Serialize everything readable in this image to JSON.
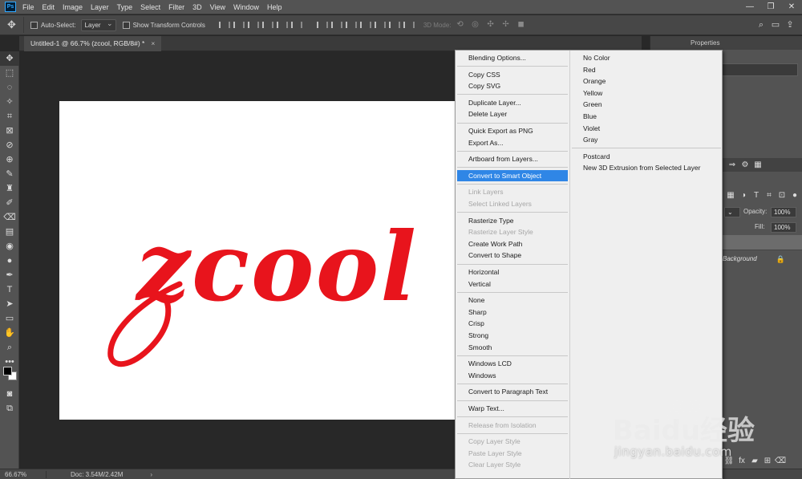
{
  "app": {
    "logo": "Ps"
  },
  "menubar": {
    "items": [
      "File",
      "Edit",
      "Image",
      "Layer",
      "Type",
      "Select",
      "Filter",
      "3D",
      "View",
      "Window",
      "Help"
    ]
  },
  "window_controls": {
    "minimize": "—",
    "restore": "❐",
    "close": "✕"
  },
  "options": {
    "auto_select_label": "Auto-Select:",
    "layer_select": "Layer",
    "show_transform_label": "Show Transform Controls",
    "mode_3d_label": "3D Mode:"
  },
  "document": {
    "tab_title": "Untitled-1 @ 66.7% (zcool, RGB/8#) *",
    "tab_close": "×",
    "canvas_text": "zcool",
    "text_color": "#e8141c"
  },
  "statusbar": {
    "zoom": "66.67%",
    "doc_size": "Doc: 3.54M/2.42M",
    "arrow": "›"
  },
  "panels": {
    "tab_label": "Properties",
    "opacity_label": "Opacity:",
    "opacity_value": "100%",
    "fill_label": "Fill:",
    "fill_value": "100%",
    "background_layer_name": "Background"
  },
  "context_menu": {
    "left": [
      {
        "label": "Blending Options...",
        "state": "normal"
      },
      {
        "sep": true
      },
      {
        "label": "Copy CSS",
        "state": "normal"
      },
      {
        "label": "Copy SVG",
        "state": "normal"
      },
      {
        "sep": true
      },
      {
        "label": "Duplicate Layer...",
        "state": "normal"
      },
      {
        "label": "Delete Layer",
        "state": "normal"
      },
      {
        "sep": true
      },
      {
        "label": "Quick Export as PNG",
        "state": "normal"
      },
      {
        "label": "Export As...",
        "state": "normal"
      },
      {
        "sep": true
      },
      {
        "label": "Artboard from Layers...",
        "state": "normal"
      },
      {
        "sep": true
      },
      {
        "label": "Convert to Smart Object",
        "state": "selected"
      },
      {
        "sep": true
      },
      {
        "label": "Link Layers",
        "state": "disabled"
      },
      {
        "label": "Select Linked Layers",
        "state": "disabled"
      },
      {
        "sep": true
      },
      {
        "label": "Rasterize Type",
        "state": "normal"
      },
      {
        "label": "Rasterize Layer Style",
        "state": "disabled"
      },
      {
        "label": "Create Work Path",
        "state": "normal"
      },
      {
        "label": "Convert to Shape",
        "state": "normal"
      },
      {
        "sep": true
      },
      {
        "label": "Horizontal",
        "state": "normal"
      },
      {
        "label": "Vertical",
        "state": "normal"
      },
      {
        "sep": true
      },
      {
        "label": "None",
        "state": "normal"
      },
      {
        "label": "Sharp",
        "state": "normal"
      },
      {
        "label": "Crisp",
        "state": "normal"
      },
      {
        "label": "Strong",
        "state": "normal"
      },
      {
        "label": "Smooth",
        "state": "normal"
      },
      {
        "sep": true
      },
      {
        "label": "Windows LCD",
        "state": "normal"
      },
      {
        "label": "Windows",
        "state": "normal"
      },
      {
        "sep": true
      },
      {
        "label": "Convert to Paragraph Text",
        "state": "normal"
      },
      {
        "sep": true
      },
      {
        "label": "Warp Text...",
        "state": "normal"
      },
      {
        "sep": true
      },
      {
        "label": "Release from Isolation",
        "state": "disabled"
      },
      {
        "sep": true
      },
      {
        "label": "Copy Layer Style",
        "state": "disabled"
      },
      {
        "label": "Paste Layer Style",
        "state": "disabled"
      },
      {
        "label": "Clear Layer Style",
        "state": "disabled"
      }
    ],
    "right": [
      {
        "label": "No Color",
        "state": "normal"
      },
      {
        "label": "Red",
        "state": "normal"
      },
      {
        "label": "Orange",
        "state": "normal"
      },
      {
        "label": "Yellow",
        "state": "normal"
      },
      {
        "label": "Green",
        "state": "normal"
      },
      {
        "label": "Blue",
        "state": "normal"
      },
      {
        "label": "Violet",
        "state": "normal"
      },
      {
        "label": "Gray",
        "state": "normal"
      },
      {
        "sep": true
      },
      {
        "label": "Postcard",
        "state": "normal"
      },
      {
        "label": "New 3D Extrusion from Selected Layer",
        "state": "normal"
      }
    ]
  },
  "watermark": {
    "brand": "Baidu经验",
    "url": "jingyan.baidu.com"
  }
}
